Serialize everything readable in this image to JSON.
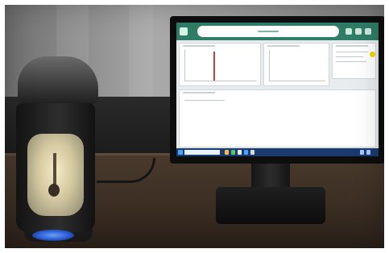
{
  "scene": {
    "subject": "",
    "colors": {
      "wall": "#8a8a8a",
      "desk": "#3b2e23",
      "instrument": "#1b1b1b",
      "indicator_light": "#2b5fe0",
      "screen_accent": "#2f7d66",
      "plot_trace": "#d43a3a",
      "status_dot": "#f2d400"
    }
  }
}
